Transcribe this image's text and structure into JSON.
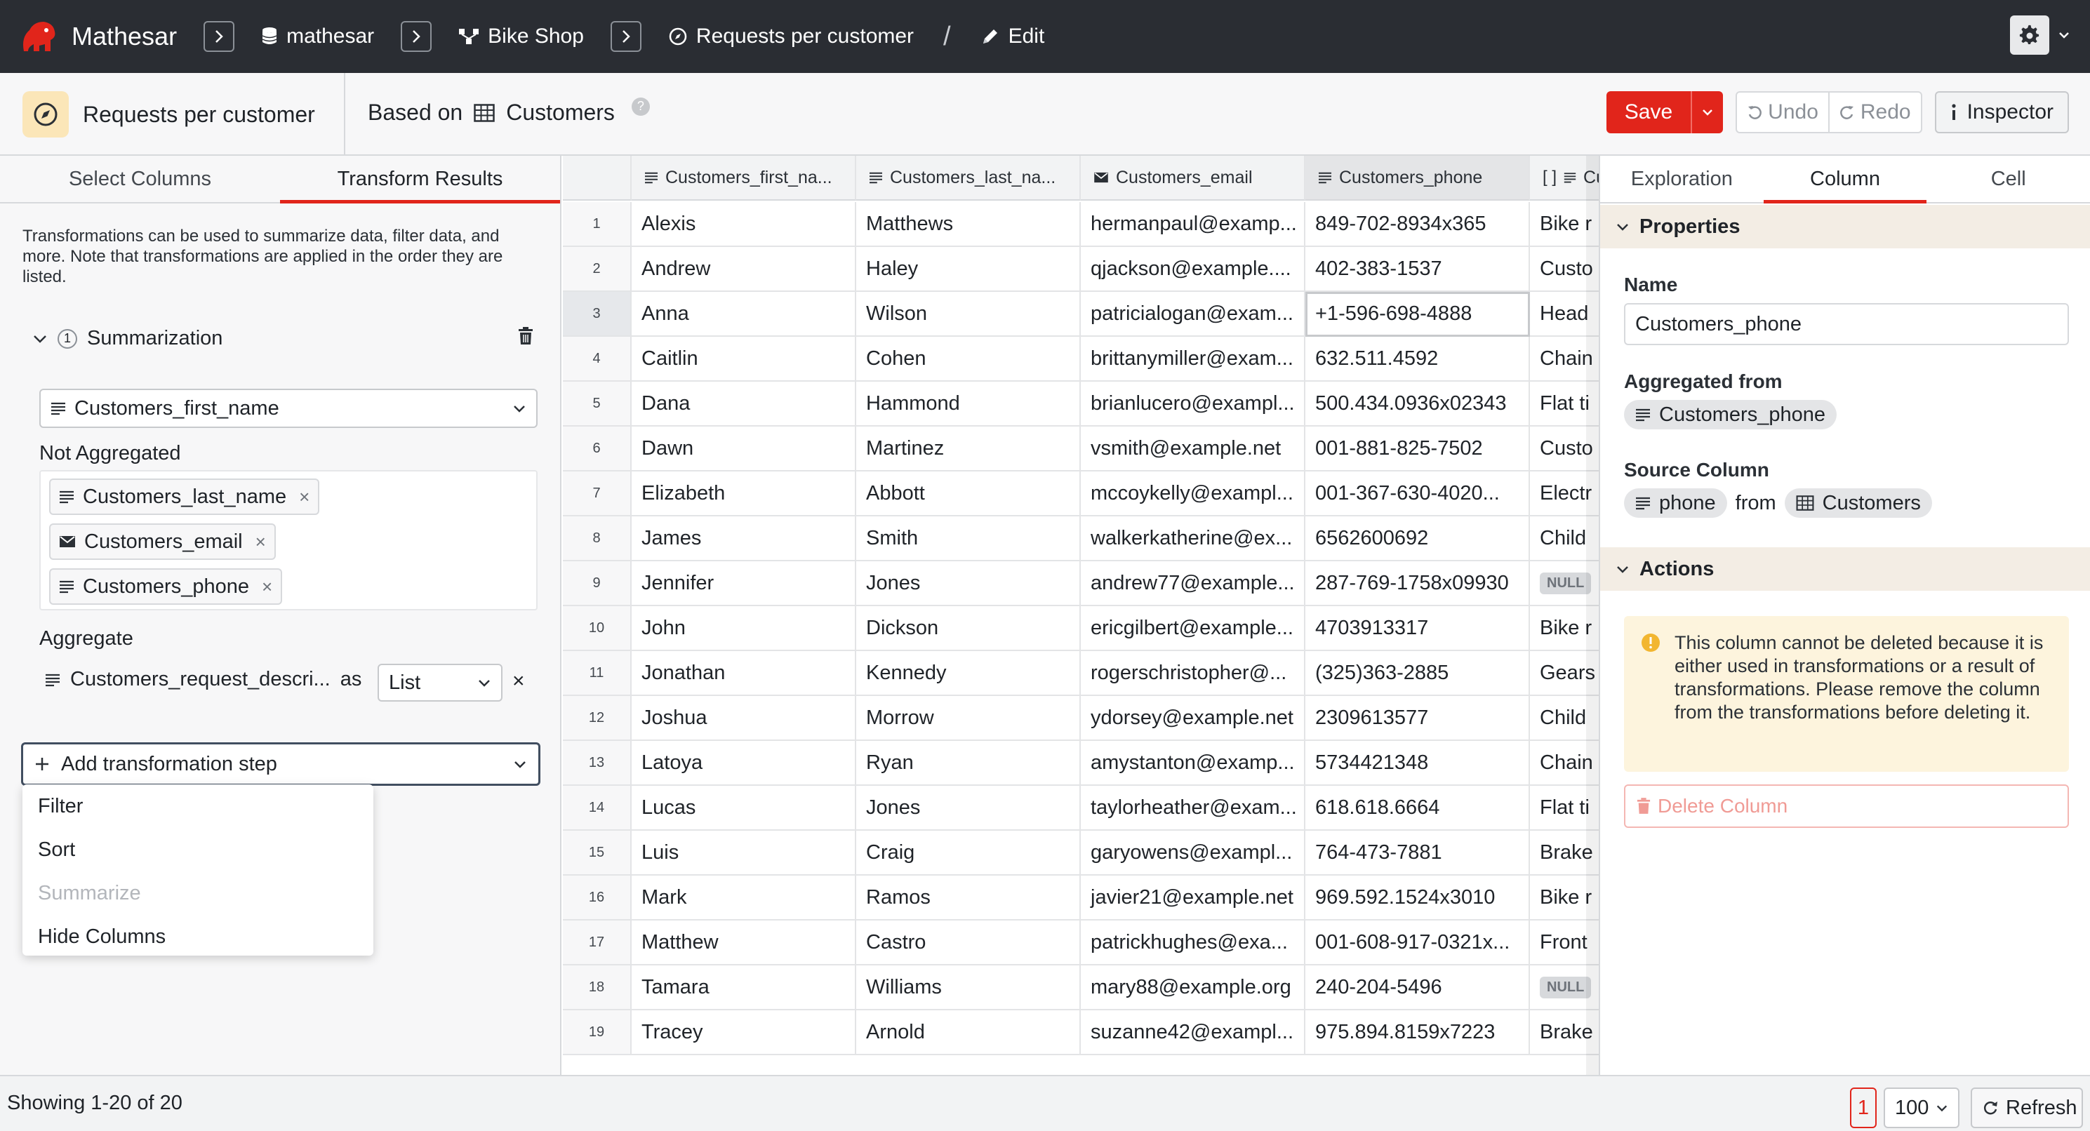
{
  "nav": {
    "app_name": "Mathesar",
    "schema": "mathesar",
    "database": "Bike Shop",
    "query": "Requests per customer",
    "mode": "Edit"
  },
  "header": {
    "query_title": "Requests per customer",
    "based_on_label": "Based on",
    "base_table": "Customers",
    "help": "?",
    "save_label": "Save",
    "undo_label": "Undo",
    "redo_label": "Redo",
    "inspector_label": "Inspector"
  },
  "left": {
    "tab_select": "Select Columns",
    "tab_transform": "Transform Results",
    "description": "Transformations can be used to summarize data, filter data, and more. Note that transformations are applied in the order they are listed.",
    "step_number": "1",
    "step_title": "Summarization",
    "group_column": "Customers_first_name",
    "not_aggregated_label": "Not Aggregated",
    "not_aggregated": [
      "Customers_last_name",
      "Customers_email",
      "Customers_phone"
    ],
    "aggregate_label": "Aggregate",
    "aggregate_column": "Customers_request_descri...",
    "aggregate_as": "as",
    "aggregate_fn": "List",
    "add_step_label": "Add transformation step",
    "menu": [
      {
        "label": "Filter"
      },
      {
        "label": "Sort"
      },
      {
        "label": "Summarize"
      },
      {
        "label": "Hide Columns"
      }
    ]
  },
  "grid": {
    "headers": [
      "Customers_first_na...",
      "Customers_last_na...",
      "Customers_email",
      "Customers_phone",
      "Cu"
    ],
    "rows": [
      [
        "1",
        "Alexis",
        "Matthews",
        "hermanpaul@examp...",
        "849-702-8934x365",
        "Bike r"
      ],
      [
        "2",
        "Andrew",
        "Haley",
        "qjackson@example....",
        "402-383-1537",
        "Custo"
      ],
      [
        "3",
        "Anna",
        "Wilson",
        "patricialogan@exam...",
        "+1-596-698-4888",
        "Head"
      ],
      [
        "4",
        "Caitlin",
        "Cohen",
        "brittanymiller@exam...",
        "632.511.4592",
        "Chain"
      ],
      [
        "5",
        "Dana",
        "Hammond",
        "brianlucero@exampl...",
        "500.434.0936x02343",
        "Flat ti"
      ],
      [
        "6",
        "Dawn",
        "Martinez",
        "vsmith@example.net",
        "001-881-825-7502",
        "Custo"
      ],
      [
        "7",
        "Elizabeth",
        "Abbott",
        "mccoykelly@exampl...",
        "001-367-630-4020...",
        "Electr"
      ],
      [
        "8",
        "James",
        "Smith",
        "walkerkatherine@ex...",
        "6562600692",
        "Child"
      ],
      [
        "9",
        "Jennifer",
        "Jones",
        "andrew77@example...",
        "287-769-1758x09930",
        "NULL"
      ],
      [
        "10",
        "John",
        "Dickson",
        "ericgilbert@example...",
        "4703913317",
        "Bike r"
      ],
      [
        "11",
        "Jonathan",
        "Kennedy",
        "rogerschristopher@...",
        "(325)363-2885",
        "Gears"
      ],
      [
        "12",
        "Joshua",
        "Morrow",
        "ydorsey@example.net",
        "2309613577",
        "Child"
      ],
      [
        "13",
        "Latoya",
        "Ryan",
        "amystanton@examp...",
        "5734421348",
        "Chain"
      ],
      [
        "14",
        "Lucas",
        "Jones",
        "taylorheather@exam...",
        "618.618.6664",
        "Flat ti"
      ],
      [
        "15",
        "Luis",
        "Craig",
        "garyowens@exampl...",
        "764-473-7881",
        "Brake"
      ],
      [
        "16",
        "Mark",
        "Ramos",
        "javier21@example.net",
        "969.592.1524x3010",
        "Bike r"
      ],
      [
        "17",
        "Matthew",
        "Castro",
        "patrickhughes@exa...",
        "001-608-917-0321x...",
        "Front"
      ],
      [
        "18",
        "Tamara",
        "Williams",
        "mary88@example.org",
        "240-204-5496",
        "NULL"
      ],
      [
        "19",
        "Tracey",
        "Arnold",
        "suzanne42@exampl...",
        "975.894.8159x7223",
        "Brake"
      ]
    ]
  },
  "inspector": {
    "tab_exploration": "Exploration",
    "tab_column": "Column",
    "tab_cell": "Cell",
    "properties_label": "Properties",
    "name_label": "Name",
    "name_value": "Customers_phone",
    "aggregated_from_label": "Aggregated from",
    "aggregated_from": "Customers_phone",
    "source_column_label": "Source Column",
    "source_column": "phone",
    "source_from": "from",
    "source_table": "Customers",
    "actions_label": "Actions",
    "warning": "This column cannot be deleted because it is either used in transformations or a result of transformations. Please remove the column from the transformations before deleting it.",
    "delete_label": "Delete Column"
  },
  "status": {
    "showing": "Showing 1-20 of 20",
    "page": "1",
    "page_size": "100",
    "refresh_label": "Refresh"
  },
  "colors": {
    "nav_bg": "#2a2d33",
    "accent": "#e1251b",
    "section_bg": "#f3ede4",
    "warning_bg": "#fdf4dd"
  }
}
